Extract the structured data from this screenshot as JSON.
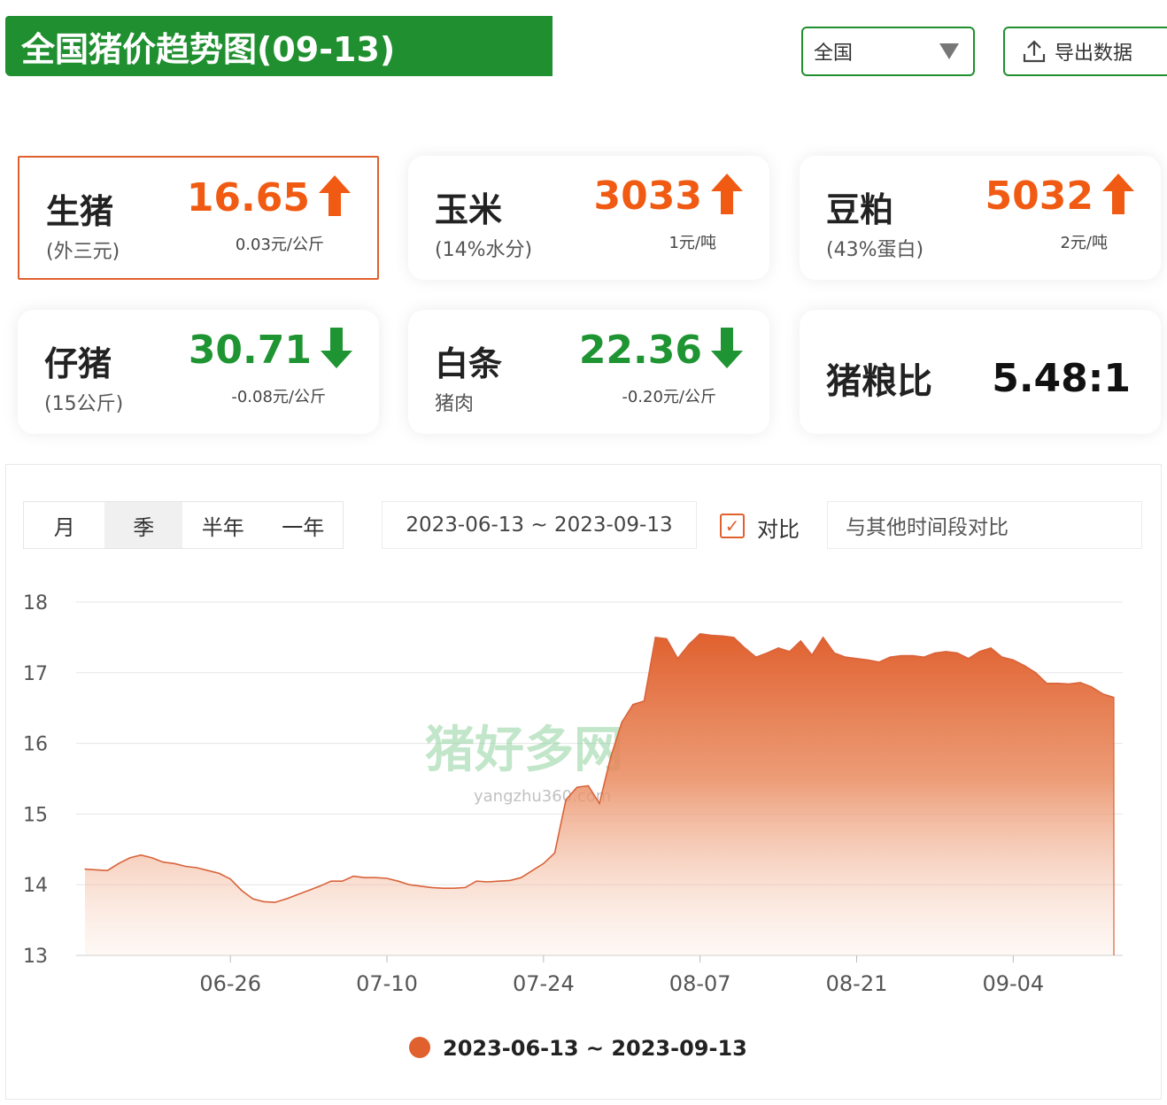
{
  "header": {
    "title": "全国猪价趋势图(09-13)",
    "region": "全国",
    "export_label": "导出数据"
  },
  "cards": [
    {
      "name": "生猪",
      "sub": "(外三元)",
      "value": "16.65",
      "change": "0.03元/公斤",
      "direction": "up",
      "selected": true
    },
    {
      "name": "玉米",
      "sub": "(14%水分)",
      "value": "3033",
      "change": "1元/吨",
      "direction": "up"
    },
    {
      "name": "豆粕",
      "sub": "(43%蛋白)",
      "value": "5032",
      "change": "2元/吨",
      "direction": "up"
    },
    {
      "name": "仔猪",
      "sub": "(15公斤)",
      "value": "30.71",
      "change": "-0.08元/公斤",
      "direction": "down"
    },
    {
      "name": "白条",
      "sub": "猪肉",
      "value": "22.36",
      "change": "-0.20元/公斤",
      "direction": "down"
    }
  ],
  "ratio": {
    "name": "猪粮比",
    "value": "5.48:1"
  },
  "controls": {
    "periods": [
      "月",
      "季",
      "半年",
      "一年"
    ],
    "active_period": "季",
    "date_range": "2023-06-13 ~ 2023-09-13",
    "compare_check": "✓",
    "compare_label": "对比",
    "compare_placeholder": "与其他时间段对比"
  },
  "watermark": {
    "text": "猪好多网",
    "sub": "yangzhu360.com"
  },
  "colors": {
    "brand_green": "#1f8f2f",
    "up": "#f05a12",
    "down": "#1f9432",
    "series": "#e0602e"
  },
  "chart_data": {
    "type": "area",
    "x": [
      "06-13",
      "06-14",
      "06-15",
      "06-16",
      "06-17",
      "06-18",
      "06-19",
      "06-20",
      "06-21",
      "06-22",
      "06-23",
      "06-24",
      "06-25",
      "06-26",
      "06-27",
      "06-28",
      "06-29",
      "06-30",
      "07-01",
      "07-02",
      "07-03",
      "07-04",
      "07-05",
      "07-06",
      "07-07",
      "07-08",
      "07-09",
      "07-10",
      "07-11",
      "07-12",
      "07-13",
      "07-14",
      "07-15",
      "07-16",
      "07-17",
      "07-18",
      "07-19",
      "07-20",
      "07-21",
      "07-22",
      "07-23",
      "07-24",
      "07-25",
      "07-26",
      "07-27",
      "07-28",
      "07-29",
      "07-30",
      "07-31",
      "08-01",
      "08-02",
      "08-03",
      "08-04",
      "08-05",
      "08-06",
      "08-07",
      "08-08",
      "08-09",
      "08-10",
      "08-11",
      "08-12",
      "08-13",
      "08-14",
      "08-15",
      "08-16",
      "08-17",
      "08-18",
      "08-19",
      "08-20",
      "08-21",
      "08-22",
      "08-23",
      "08-24",
      "08-25",
      "08-26",
      "08-27",
      "08-28",
      "08-29",
      "08-30",
      "08-31",
      "09-01",
      "09-02",
      "09-03",
      "09-04",
      "09-05",
      "09-06",
      "09-07",
      "09-08",
      "09-09",
      "09-10",
      "09-11",
      "09-12",
      "09-13"
    ],
    "series": [
      {
        "name": "2023-06-13 ~ 2023-09-13",
        "values": [
          14.22,
          14.21,
          14.2,
          14.3,
          14.38,
          14.42,
          14.38,
          14.32,
          14.3,
          14.26,
          14.24,
          14.2,
          14.16,
          14.08,
          13.92,
          13.8,
          13.76,
          13.75,
          13.8,
          13.86,
          13.92,
          13.98,
          14.05,
          14.05,
          14.12,
          14.1,
          14.1,
          14.09,
          14.05,
          14.0,
          13.98,
          13.96,
          13.95,
          13.95,
          13.96,
          14.05,
          14.04,
          14.05,
          14.06,
          14.1,
          14.2,
          14.3,
          14.45,
          15.2,
          15.38,
          15.4,
          15.15,
          15.8,
          16.3,
          16.55,
          16.6,
          17.5,
          17.48,
          17.2,
          17.4,
          17.55,
          17.53,
          17.52,
          17.5,
          17.35,
          17.22,
          17.28,
          17.35,
          17.3,
          17.45,
          17.25,
          17.5,
          17.28,
          17.22,
          17.2,
          17.18,
          17.15,
          17.22,
          17.24,
          17.24,
          17.22,
          17.28,
          17.3,
          17.28,
          17.2,
          17.3,
          17.35,
          17.22,
          17.18,
          17.1,
          17.0,
          16.85,
          16.85,
          16.84,
          16.86,
          16.8,
          16.7,
          16.65
        ]
      }
    ],
    "x_tick_labels": [
      "06-26",
      "07-10",
      "07-24",
      "08-07",
      "08-21",
      "09-04"
    ],
    "y_ticks": [
      13,
      14,
      15,
      16,
      17,
      18
    ],
    "ylim": [
      13,
      18
    ],
    "grid": true,
    "legend": "bottom-center"
  }
}
